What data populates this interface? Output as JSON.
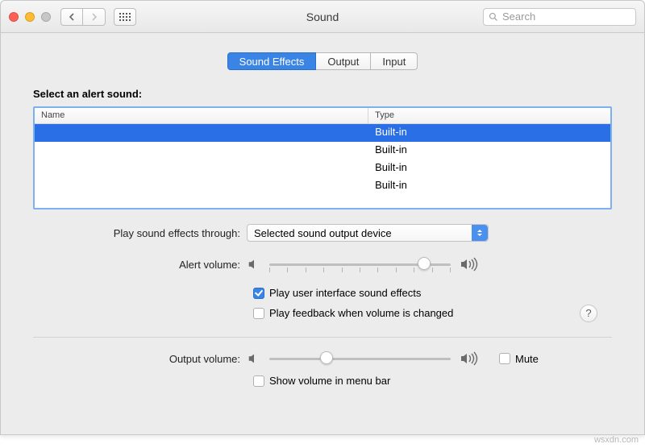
{
  "window": {
    "title": "Sound"
  },
  "toolbar": {
    "search_placeholder": "Search"
  },
  "tabs": {
    "effects": "Sound Effects",
    "output": "Output",
    "input": "Input"
  },
  "alerts": {
    "section_title": "Select an alert sound:",
    "col_name": "Name",
    "col_type": "Type",
    "rows": [
      {
        "name": "",
        "type": "Built-in"
      },
      {
        "name": "",
        "type": "Built-in"
      },
      {
        "name": "",
        "type": "Built-in"
      },
      {
        "name": "",
        "type": "Built-in"
      }
    ]
  },
  "controls": {
    "play_through_label": "Play sound effects through:",
    "play_through_value": "Selected sound output device",
    "alert_volume_label": "Alert volume:",
    "alert_volume_percent": 88,
    "cb_ui_sfx": "Play user interface sound effects",
    "cb_ui_sfx_checked": true,
    "cb_feedback": "Play feedback when volume is changed",
    "cb_feedback_checked": false,
    "output_volume_label": "Output volume:",
    "output_volume_percent": 30,
    "mute_label": "Mute",
    "mute_checked": false,
    "cb_menubar": "Show volume in menu bar",
    "cb_menubar_checked": false
  },
  "help": "?",
  "watermark": "wsxdn.com"
}
